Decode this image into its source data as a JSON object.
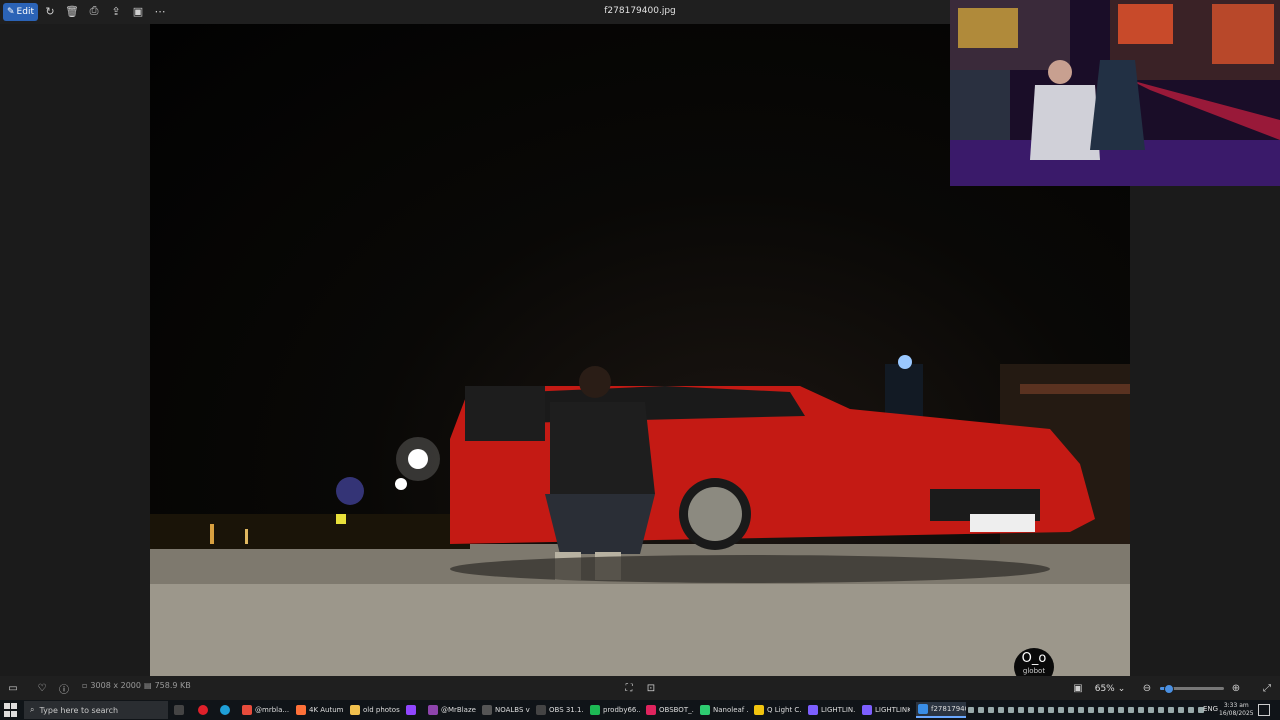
{
  "toolbar": {
    "edit_label": "Edit",
    "file_name": "f278179400.jpg",
    "icons": [
      "rotate-icon",
      "delete-icon",
      "print-icon",
      "share-icon",
      "slideshow-icon",
      "more-icon"
    ]
  },
  "status": {
    "dimensions": "3008 x 2000",
    "file_size": "758.9 KB",
    "zoom": "65%",
    "zoom_fraction": 0.12
  },
  "overlay": {
    "badge_face": "O_o",
    "badge_name": "globot"
  },
  "taskbar": {
    "search_placeholder": "Type here to search",
    "apps": [
      {
        "label": "@mrbla...",
        "color": "#e74c3c"
      },
      {
        "label": "4K Autum...",
        "color": "#ff7139"
      },
      {
        "label": "old photos",
        "color": "#f2c14e"
      },
      {
        "label": "",
        "color": "#9146ff"
      },
      {
        "label": "@MrBlaze...",
        "color": "#8e44ad"
      },
      {
        "label": "NOALBS v2",
        "color": "#555555"
      },
      {
        "label": "OBS 31.1.1...",
        "color": "#444444"
      },
      {
        "label": "prodby66...",
        "color": "#1db954"
      },
      {
        "label": "OBSBOT_...",
        "color": "#e0245e"
      },
      {
        "label": "Nanoleaf ...",
        "color": "#2ecc71"
      },
      {
        "label": "Q Light C...",
        "color": "#f1c40f"
      },
      {
        "label": "LIGHTLIN...",
        "color": "#7d5fff"
      },
      {
        "label": "LIGHTLINK",
        "color": "#7d5fff"
      },
      {
        "label": "f27817940...",
        "color": "#3a8ee6"
      }
    ],
    "language": "ENG",
    "time": "3:33 am",
    "date": "16/08/2025"
  }
}
